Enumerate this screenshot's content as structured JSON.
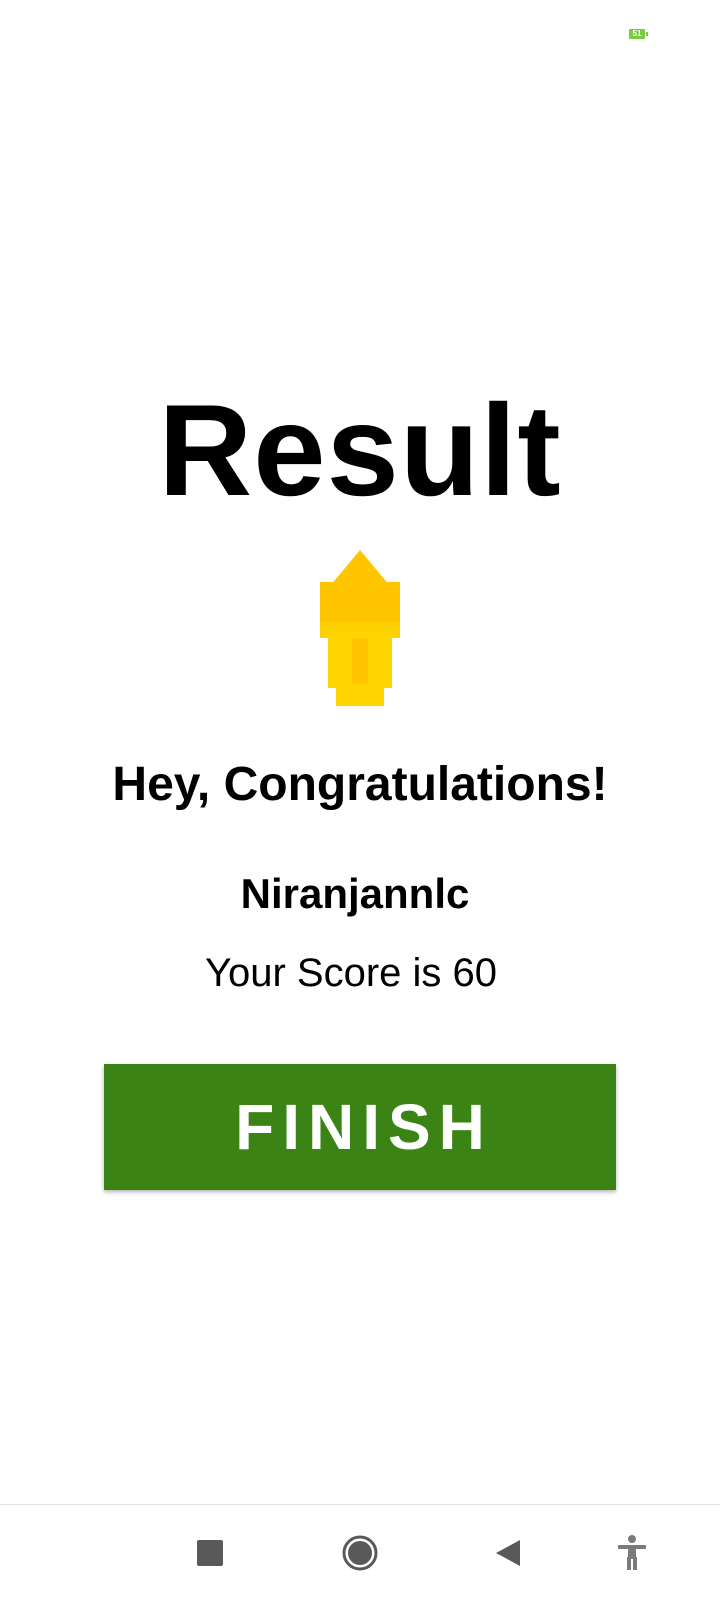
{
  "status_bar": {
    "battery_level": "51",
    "battery_color": "#7ac943"
  },
  "result": {
    "title": "Result",
    "trophy_icon": "trophy-icon",
    "congrats_text": "Hey, Congratulations!",
    "username": "Niranjannlc",
    "score_text": "Your Score is 60",
    "finish_label": "FINISH",
    "finish_color": "#3a8314"
  },
  "nav_bar": {
    "recent_icon": "square-icon",
    "home_icon": "circle-icon",
    "back_icon": "triangle-back-icon",
    "accessibility_icon": "accessibility-icon"
  }
}
